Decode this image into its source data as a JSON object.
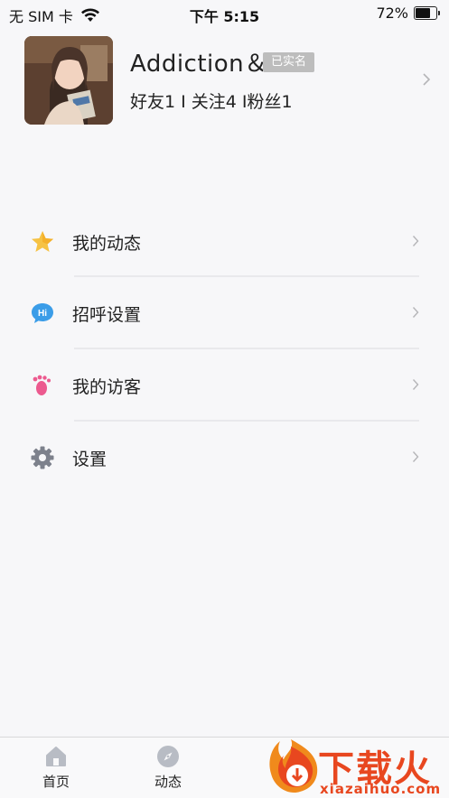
{
  "status_bar": {
    "carrier": "无 SIM 卡",
    "time": "下午 5:15",
    "battery_percent": "72%",
    "battery_level": 0.72
  },
  "profile": {
    "username": "Addiction＆",
    "verified_badge": "已实名",
    "stats": "好友1 I 关注4 I粉丝1"
  },
  "menu": {
    "items": [
      {
        "label": "我的动态",
        "icon": "star-icon"
      },
      {
        "label": "招呼设置",
        "icon": "hi-chat-icon"
      },
      {
        "label": "我的访客",
        "icon": "footprint-icon"
      },
      {
        "label": "设置",
        "icon": "gear-icon"
      }
    ]
  },
  "tabbar": {
    "tabs": [
      {
        "label": "首页",
        "icon": "home-icon"
      },
      {
        "label": "动态",
        "icon": "compass-icon"
      }
    ]
  },
  "watermark": {
    "text": "下载火",
    "domain": "xiazaihuo.com"
  },
  "colors": {
    "background": "#f7f7f9",
    "star": "#f6c243",
    "hi_bubble": "#3b9de8",
    "footprint": "#ec5a8f",
    "gear": "#7d818c",
    "badge": "#bdbdbd",
    "watermark": "#e8471f"
  }
}
